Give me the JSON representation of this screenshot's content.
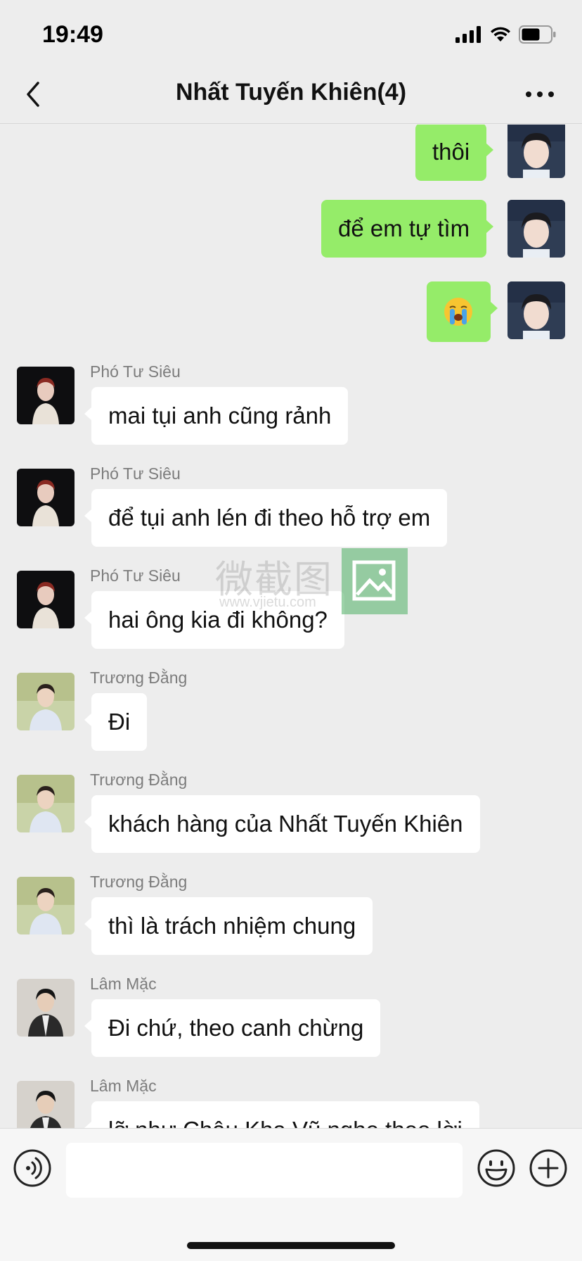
{
  "status": {
    "time": "19:49"
  },
  "header": {
    "title": "Nhất Tuyến Khiên(4)"
  },
  "watermark": {
    "text": "微截图",
    "url": "www.vjietu.com"
  },
  "messages": [
    {
      "side": "out",
      "text": "thôi"
    },
    {
      "side": "out",
      "text": "để em tự tìm"
    },
    {
      "side": "out",
      "emoji": "loudly-crying-face"
    },
    {
      "side": "in",
      "sender": "Phó Tư Siêu",
      "text": "mai tụi anh cũng rảnh"
    },
    {
      "side": "in",
      "sender": "Phó Tư Siêu",
      "text": "để tụi anh lén đi theo hỗ trợ em"
    },
    {
      "side": "in",
      "sender": "Phó Tư Siêu",
      "text": "hai ông kia đi không?"
    },
    {
      "side": "in",
      "sender": "Trương Đằng",
      "text": "Đi"
    },
    {
      "side": "in",
      "sender": "Trương Đằng",
      "text": "khách hàng của Nhất Tuyến Khiên"
    },
    {
      "side": "in",
      "sender": "Trương Đằng",
      "text": "thì là trách nhiệm chung"
    },
    {
      "side": "in",
      "sender": "Lâm Mặc",
      "text": "Đi chứ, theo canh chừng"
    },
    {
      "side": "in",
      "sender": "Lâm Mặc",
      "text": "lỡ như Châu Kha Vũ nghe theo lời"
    }
  ],
  "colors": {
    "background": "#ededed",
    "outgoing_bubble": "#95ec69",
    "incoming_bubble": "#ffffff"
  }
}
